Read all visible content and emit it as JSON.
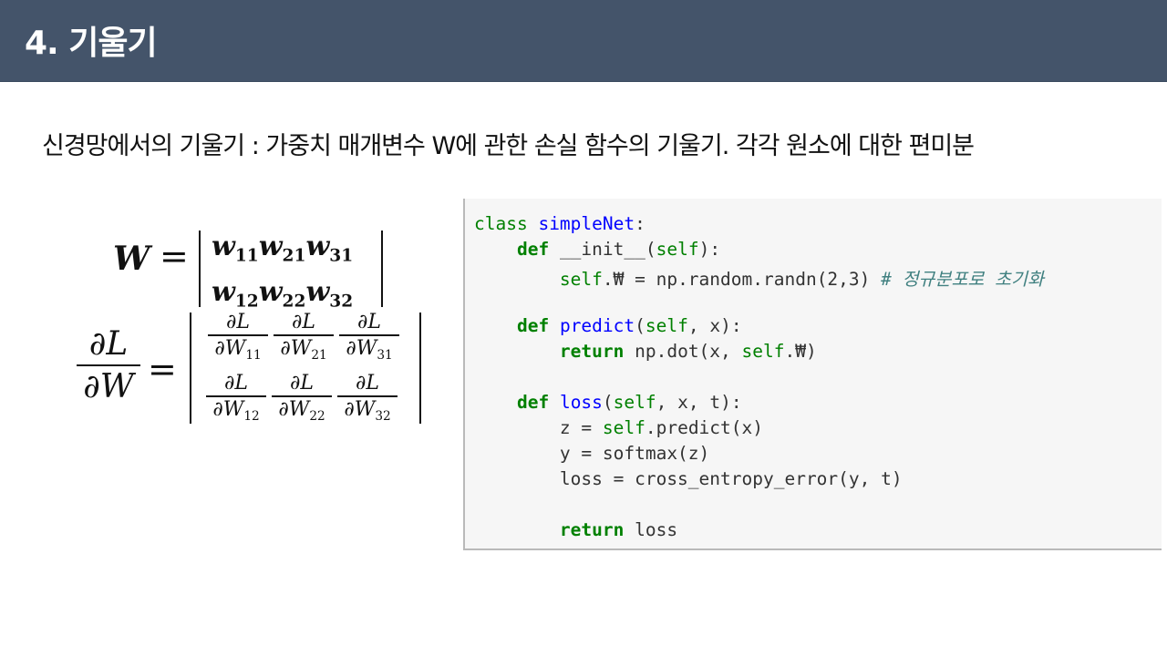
{
  "header": {
    "title": "4. 기울기"
  },
  "subtitle": "신경망에서의 기울기 : 가중치 매개변수 W에 관한 손실 함수의 기울기. 각각 원소에 대한 편미분",
  "math": {
    "W_symbol": "W",
    "equals": "=",
    "w_row1": [
      "w",
      "11",
      "w",
      "21",
      "w",
      "31"
    ],
    "w_row2": [
      "w",
      "12",
      "w",
      "22",
      "w",
      "32"
    ],
    "lhs_num": "∂L",
    "lhs_den": "∂W",
    "grad_numerator": "∂L",
    "grad_row1": [
      "∂W11",
      "∂W21",
      "∂W31"
    ],
    "grad_row2": [
      "∂W12",
      "∂W22",
      "∂W32"
    ]
  },
  "code": {
    "line1": [
      "class",
      " ",
      "simpleNet",
      ":"
    ],
    "line2": [
      "def",
      " __init__(",
      "self",
      "):"
    ],
    "line3": [
      "self",
      ".₩ = np.random.randn(2,3) ",
      "# 정규분포로 초기화"
    ],
    "line5": [
      "def",
      " ",
      "predict",
      "(",
      "self",
      ", x):"
    ],
    "line6": [
      "return",
      " np.dot(x, ",
      "self",
      ".₩)"
    ],
    "line8": [
      "def",
      " ",
      "loss",
      "(",
      "self",
      ", x, t):"
    ],
    "line9": [
      "z = ",
      "self",
      ".predict(x)"
    ],
    "line10": "y = softmax(z)",
    "line11": "loss = cross_entropy_error(y, t)",
    "line13": [
      "return",
      " loss"
    ]
  }
}
